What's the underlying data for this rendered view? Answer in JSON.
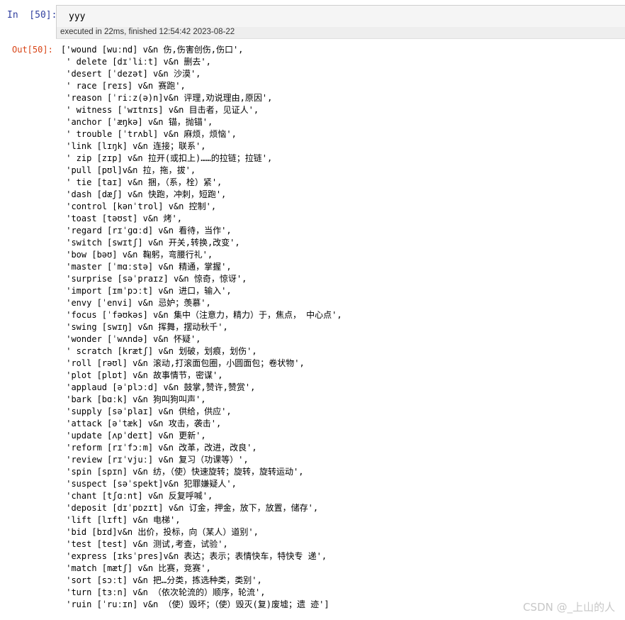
{
  "cell": {
    "in_prompt": "In  [50]:",
    "input_code": "yyy",
    "exec_info": "executed in 22ms, finished 12:54:42 2023-08-22",
    "out_prompt": "Out[50]:"
  },
  "output_lines": [
    "['wound [wuːnd] v&n 伤,伤害创伤,伤口',",
    " ' delete [dɪˈliːt] v&n 删去',",
    " 'desert [ˈdezət] v&n 沙漠',",
    " ' race [reɪs] v&n 赛跑',",
    " 'reason [ˈriːz(ə)n]v&n 评理,劝说理由,原因',",
    " ' witness [ˈwɪtnɪs] v&n 目击者，见证人',",
    " 'anchor [ˈæŋkə] v&n 锚，抛锚',",
    " ' trouble [ˈtrʌbl] v&n 麻烦，烦恼',",
    " 'link [lɪŋk] v&n 连接；联系',",
    " ' zip [zɪp] v&n 拉开(或扣上)……的拉链；拉链',",
    " 'pull [pʊl]v&n 拉，拖，拔',",
    " ' tie [taɪ] v&n 捆，（系，栓）紧',",
    " 'dash [dæʃ] v&n 快跑，冲刺，短跑',",
    " 'control [kənˈtrol] v&n 控制',",
    " 'toast [təʊst] v&n 烤',",
    " 'regard [rɪˈɡɑːd] v&n 看待，当作',",
    " 'switch [swɪtʃ] v&n 开关,转换,改变',",
    " 'bow [bəʊ] v&n 鞠躬，弯腰行礼',",
    " 'master [ˈmɑːstə] v&n 精通，掌握',",
    " 'surprise [səˈpraɪz] v&n 惊奇，惊讶',",
    " 'import [ɪmˈpɔːt] v&n 进口，输入',",
    " 'envy [ˈenvi] v&n 忌妒；羡慕',",
    " 'focus [ˈfəʊkəs] v&n 集中（注意力，精力）于，焦点， 中心点',",
    " 'swing [swɪŋ] v&n 挥舞，摆动秋千',",
    " 'wonder [ˈwʌndə] v&n 怀疑',",
    " ' scratch [krætʃ] v&n 划破，划痕，划伤',",
    " 'roll [rəʊl] v&n 滚动,打滚面包圈，小圆面包；卷状物',",
    " 'plot [plɒt] v&n 故事情节，密谋',",
    " 'applaud [əˈplɔːd] v&n 鼓掌,赞许,赞赏',",
    " 'bark [bɑːk] v&n 狗叫狗叫声',",
    " 'supply [səˈplaɪ] v&n 供给，供应',",
    " 'attack [əˈtæk] v&n 攻击，袭击',",
    " 'update [ʌpˈdeɪt] v&n 更新',",
    " 'reform [rɪˈfɔːm] v&n 改革，改进，改良',",
    " 'review [rɪˈvjuː] v&n 复习（功课等）',",
    " 'spin [spɪn] v&n 纺，（使）快速旋转；旋转，旋转运动',",
    " 'suspect [səˈspekt]v&n 犯罪嫌疑人',",
    " 'chant [tʃɑːnt] v&n 反复呼喊',",
    " 'deposit [dɪˈpɒzɪt] v&n 订金，押金，放下，放置，储存',",
    " 'lift [lɪft] v&n 电梯',",
    " 'bid [bɪd]v&n 出价，投标，向（某人）道别',",
    " 'test [test] v&n 测试,考查，试验',",
    " 'express [ɪksˈpres]v&n 表达；表示；表情快车，特快专 递',",
    " 'match [mætʃ] v&n 比赛，竞赛',",
    " 'sort [sɔːt] v&n 把…分类，拣选种类，类别',",
    " 'turn [tɜːn] v&n （依次轮流的）顺序，轮流',",
    " 'ruin [ˈruːɪn] v&n （使）毁坏；（使）毁灭(复)废墟；遗 迹']"
  ],
  "watermark": "CSDN @_上山的人"
}
